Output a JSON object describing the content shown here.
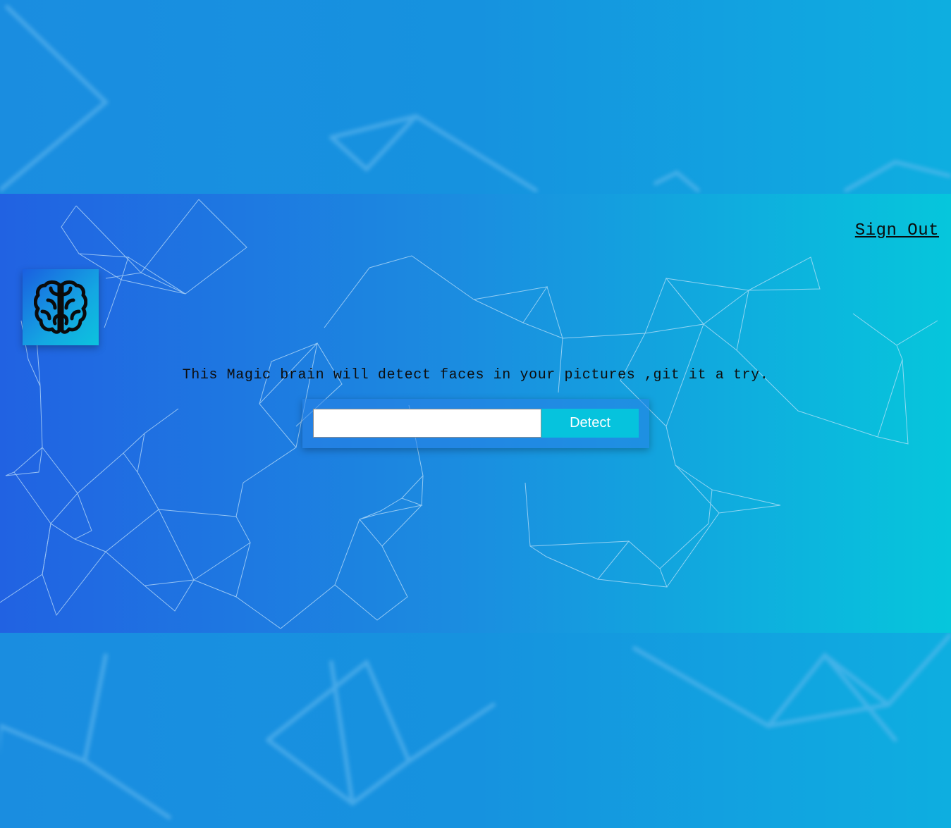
{
  "header": {
    "sign_out_label": "Sign Out"
  },
  "logo": {
    "icon": "brain-icon"
  },
  "main": {
    "tagline": "This Magic brain will detect faces in your pictures ,git it a try.",
    "url_input": {
      "value": "",
      "placeholder": ""
    },
    "detect_label": "Detect"
  },
  "colors": {
    "banner_left": "#2162e2",
    "banner_right": "#06c6dc",
    "button": "#06c3dd",
    "page_bg": "#1692df"
  }
}
